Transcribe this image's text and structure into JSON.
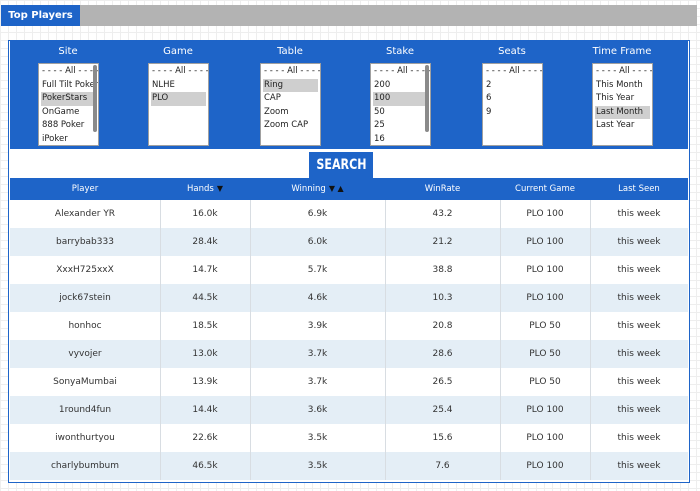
{
  "tab": {
    "label": "Top Players"
  },
  "filters": [
    {
      "key": "site",
      "label": "Site",
      "options": [
        "- - - - All - - - -",
        "Full Tilt Poker",
        "PokerStars",
        "OnGame",
        "888 Poker",
        "iPoker"
      ],
      "selected": [
        2
      ],
      "scroll": true
    },
    {
      "key": "game",
      "label": "Game",
      "options": [
        "- - - - All - - - -",
        "NLHE",
        "PLO"
      ],
      "selected": [
        2
      ],
      "scroll": false
    },
    {
      "key": "table",
      "label": "Table",
      "options": [
        "- - - - All - - - -",
        "Ring",
        "CAP",
        "Zoom",
        "Zoom CAP"
      ],
      "selected": [
        1
      ],
      "scroll": false
    },
    {
      "key": "stake",
      "label": "Stake",
      "options": [
        "- - - - All - - - -",
        "200",
        "100",
        "50",
        "25",
        "16"
      ],
      "selected": [
        2
      ],
      "scroll": true
    },
    {
      "key": "seats",
      "label": "Seats",
      "options": [
        "- - - - All - - - -",
        "2",
        "6",
        "9"
      ],
      "selected": [],
      "scroll": false
    },
    {
      "key": "timeframe",
      "label": "Time Frame",
      "options": [
        "- - - - All - - - -",
        "This Month",
        "This Year",
        "Last Month",
        "Last Year"
      ],
      "selected": [
        3
      ],
      "scroll": false
    }
  ],
  "search": {
    "label": "SEARCH"
  },
  "columns": [
    {
      "key": "player",
      "label": "Player"
    },
    {
      "key": "hands",
      "label": "Hands",
      "arrows": "▼"
    },
    {
      "key": "winning",
      "label": "Winning",
      "arrows": "▼ ▲"
    },
    {
      "key": "winrate",
      "label": "WinRate"
    },
    {
      "key": "current_game",
      "label": "Current Game"
    },
    {
      "key": "last_seen",
      "label": "Last Seen"
    }
  ],
  "rows": [
    {
      "player": "Alexander YR",
      "hands": "16.0k",
      "winning": "6.9k",
      "winrate": "43.2",
      "current_game": "PLO 100",
      "last_seen": "this week"
    },
    {
      "player": "barrybab333",
      "hands": "28.4k",
      "winning": "6.0k",
      "winrate": "21.2",
      "current_game": "PLO 100",
      "last_seen": "this week"
    },
    {
      "player": "XxxH725xxX",
      "hands": "14.7k",
      "winning": "5.7k",
      "winrate": "38.8",
      "current_game": "PLO 100",
      "last_seen": "this week"
    },
    {
      "player": "jock67stein",
      "hands": "44.5k",
      "winning": "4.6k",
      "winrate": "10.3",
      "current_game": "PLO 100",
      "last_seen": "this week"
    },
    {
      "player": "honhoc",
      "hands": "18.5k",
      "winning": "3.9k",
      "winrate": "20.8",
      "current_game": "PLO 50",
      "last_seen": "this week"
    },
    {
      "player": "vyvojer",
      "hands": "13.0k",
      "winning": "3.7k",
      "winrate": "28.6",
      "current_game": "PLO 50",
      "last_seen": "this week"
    },
    {
      "player": "SonyaMumbai",
      "hands": "13.9k",
      "winning": "3.7k",
      "winrate": "26.5",
      "current_game": "PLO 50",
      "last_seen": "this week"
    },
    {
      "player": "1round4fun",
      "hands": "14.4k",
      "winning": "3.6k",
      "winrate": "25.4",
      "current_game": "PLO 100",
      "last_seen": "this week"
    },
    {
      "player": "iwonthurtyou",
      "hands": "22.6k",
      "winning": "3.5k",
      "winrate": "15.6",
      "current_game": "PLO 100",
      "last_seen": "this week"
    },
    {
      "player": "charlybumbum",
      "hands": "46.5k",
      "winning": "3.5k",
      "winrate": "7.6",
      "current_game": "PLO 100",
      "last_seen": "this week"
    }
  ],
  "colors": {
    "accent": "#1e64c8",
    "header_bar": "#b3b3b3",
    "row_alt": "#e4eef6",
    "selected_option": "#cfcfcf"
  }
}
